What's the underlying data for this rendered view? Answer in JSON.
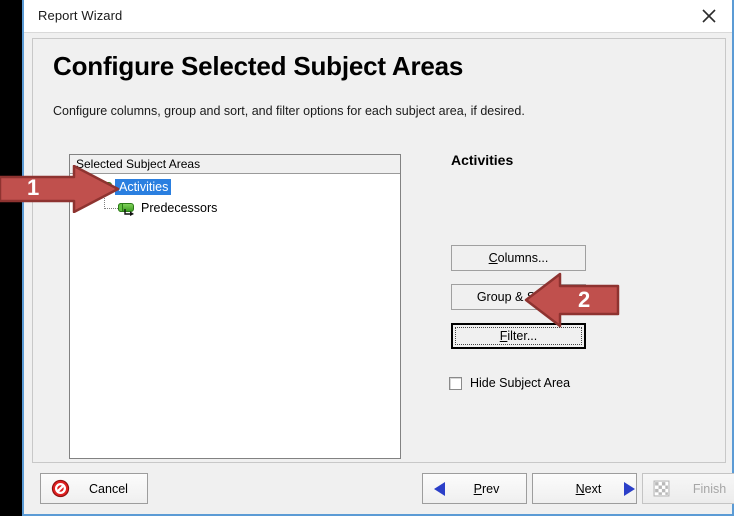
{
  "window": {
    "title": "Report Wizard",
    "close_icon": "close-icon"
  },
  "page": {
    "title": "Configure Selected Subject Areas",
    "subtitle": "Configure columns, group and sort, and filter options for each subject area, if desired."
  },
  "tree": {
    "header": "Selected Subject Areas",
    "nodes": [
      {
        "label": "Activities",
        "icon": "subject-area-icon",
        "selected": true,
        "level": 0
      },
      {
        "label": "Predecessors",
        "icon": "subject-area-link-icon",
        "selected": false,
        "level": 1
      }
    ]
  },
  "right_pane": {
    "title": "Activities",
    "buttons": [
      {
        "id": "columns",
        "label": "Columns...",
        "mnemonic": "C",
        "default": false
      },
      {
        "id": "group_sort",
        "label": "Group & Sort...",
        "mnemonic": "",
        "default": false
      },
      {
        "id": "filter",
        "label": "Filter...",
        "mnemonic": "F",
        "default": true
      }
    ],
    "checkbox": {
      "label": "Hide Subject Area",
      "checked": false
    }
  },
  "footer": {
    "cancel": {
      "label": "Cancel",
      "icon": "cancel-icon",
      "enabled": true
    },
    "prev": {
      "label": "Prev",
      "mnemonic": "P",
      "icon": "triangle-left-icon",
      "enabled": true
    },
    "next": {
      "label": "Next",
      "mnemonic": "N",
      "icon": "triangle-right-icon",
      "enabled": true
    },
    "finish": {
      "label": "Finish",
      "icon": "checkered-flag-icon",
      "enabled": false
    }
  },
  "annotations": [
    {
      "number": "1",
      "direction": "right",
      "target": "activities-tree-node"
    },
    {
      "number": "2",
      "direction": "left",
      "target": "filter-button"
    }
  ],
  "colors": {
    "annotation_red": "#C0504D",
    "annotation_red_dark": "#8E3330",
    "selection_blue": "#2A7FE0",
    "window_border_blue": "#5B9BD5",
    "nav_arrow_blue": "#2B3FC8",
    "subject_icon_green": "#4FAE2C",
    "cancel_red": "#E02020"
  }
}
